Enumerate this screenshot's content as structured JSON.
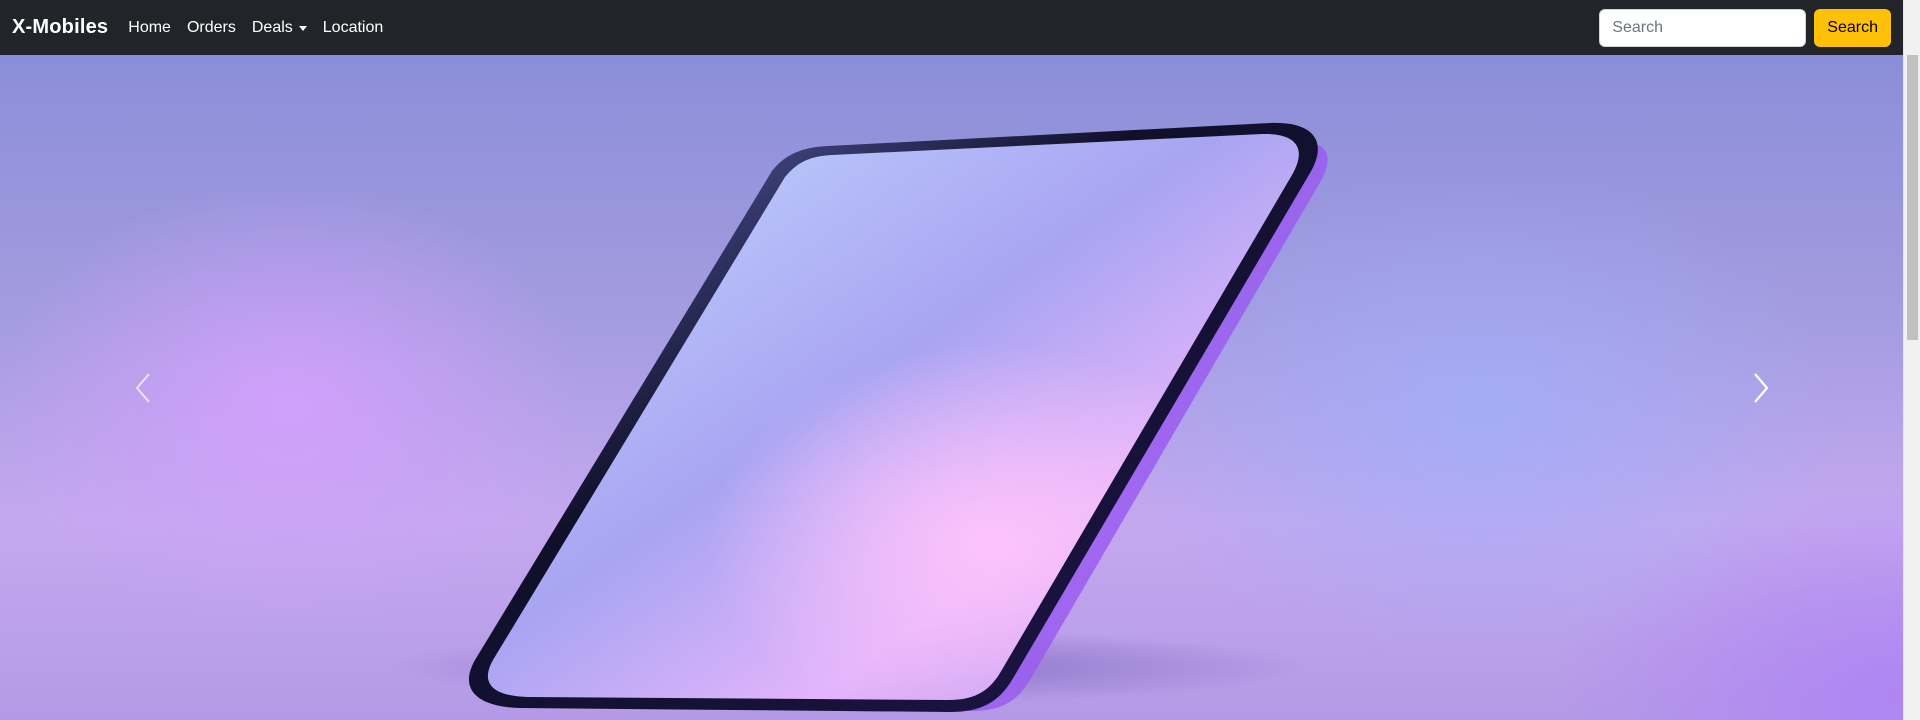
{
  "navbar": {
    "brand": "X-Mobiles",
    "links": [
      {
        "label": "Home"
      },
      {
        "label": "Orders"
      },
      {
        "label": "Deals",
        "dropdown": true
      },
      {
        "label": "Location"
      }
    ],
    "search": {
      "placeholder": "Search",
      "value": "",
      "button_label": "Search"
    },
    "colors": {
      "background": "#212529",
      "search_button": "#ffc107"
    }
  },
  "carousel": {
    "image_subject": "smartphone",
    "prev_icon": "chevron-left-icon",
    "next_icon": "chevron-right-icon"
  }
}
